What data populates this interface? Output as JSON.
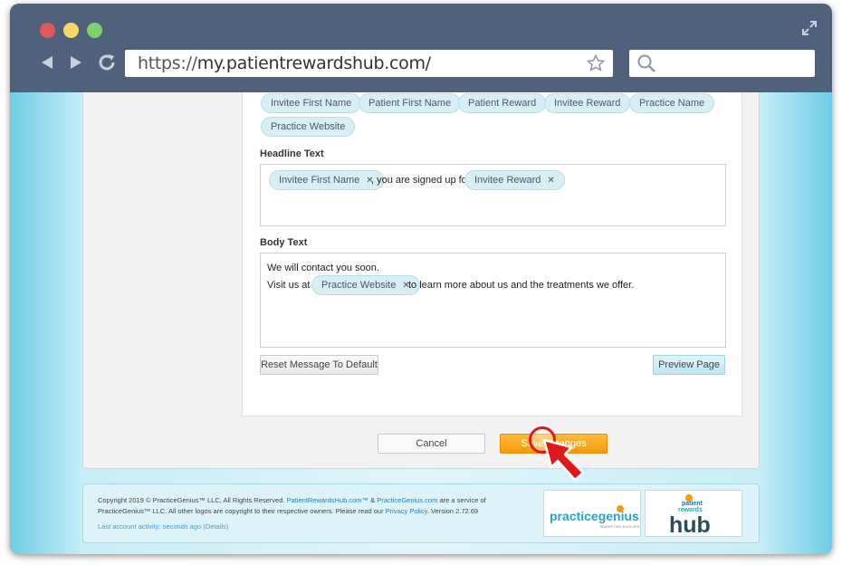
{
  "browser": {
    "url_prefix": "https://",
    "url_rest": "my.patientrewardshub.com/",
    "icons": [
      "back-arrow-icon",
      "forward-arrow-icon",
      "reload-icon",
      "star-icon",
      "search-icon",
      "expand-icon"
    ]
  },
  "tokens": [
    "Invitee First Name",
    "Patient First Name",
    "Patient Reward",
    "Invitee Reward",
    "Practice Name",
    "Practice Website"
  ],
  "headline": {
    "label": "Headline Text",
    "chip1": "Invitee First Name",
    "middle_text": ", you are signed up for",
    "chip2": "Invitee Reward"
  },
  "body": {
    "label": "Body Text",
    "line1": "We will contact you soon.",
    "line2_pre": "Visit us at",
    "chip": "Practice Website",
    "line2_post": "to learn more about us and the treatments we offer."
  },
  "buttons": {
    "reset": "Reset Message To Default",
    "preview": "Preview Page",
    "cancel": "Cancel",
    "save": "Save Changes"
  },
  "footer": {
    "copy1": "Copyright 2019 © PracticeGenius™ LLC, All Rights Reserved.",
    "link1": "PatientRewardsHub.com™",
    "amp": "&",
    "link2": "PracticeGenius.com",
    "copy2": "are a service of PracticeGenius™ LLC. All other logos are copyright to their respective owners. Please read our",
    "privacy": "Privacy Policy",
    "version": ". Version 2.72.69",
    "activity": "Last account activity: seconds ago (Details)",
    "logo_pg_main": "practicegenius",
    "logo_pg_tag": "MARKETING EVOLVED",
    "logo_hub_top": "patient",
    "logo_hub_mid": "rewards",
    "logo_hub_main": "hub"
  },
  "colors": {
    "chrome": "#50617c",
    "accent": "#f59b0a",
    "chip_bg": "#d8eef5",
    "cursor": "#e01818"
  }
}
